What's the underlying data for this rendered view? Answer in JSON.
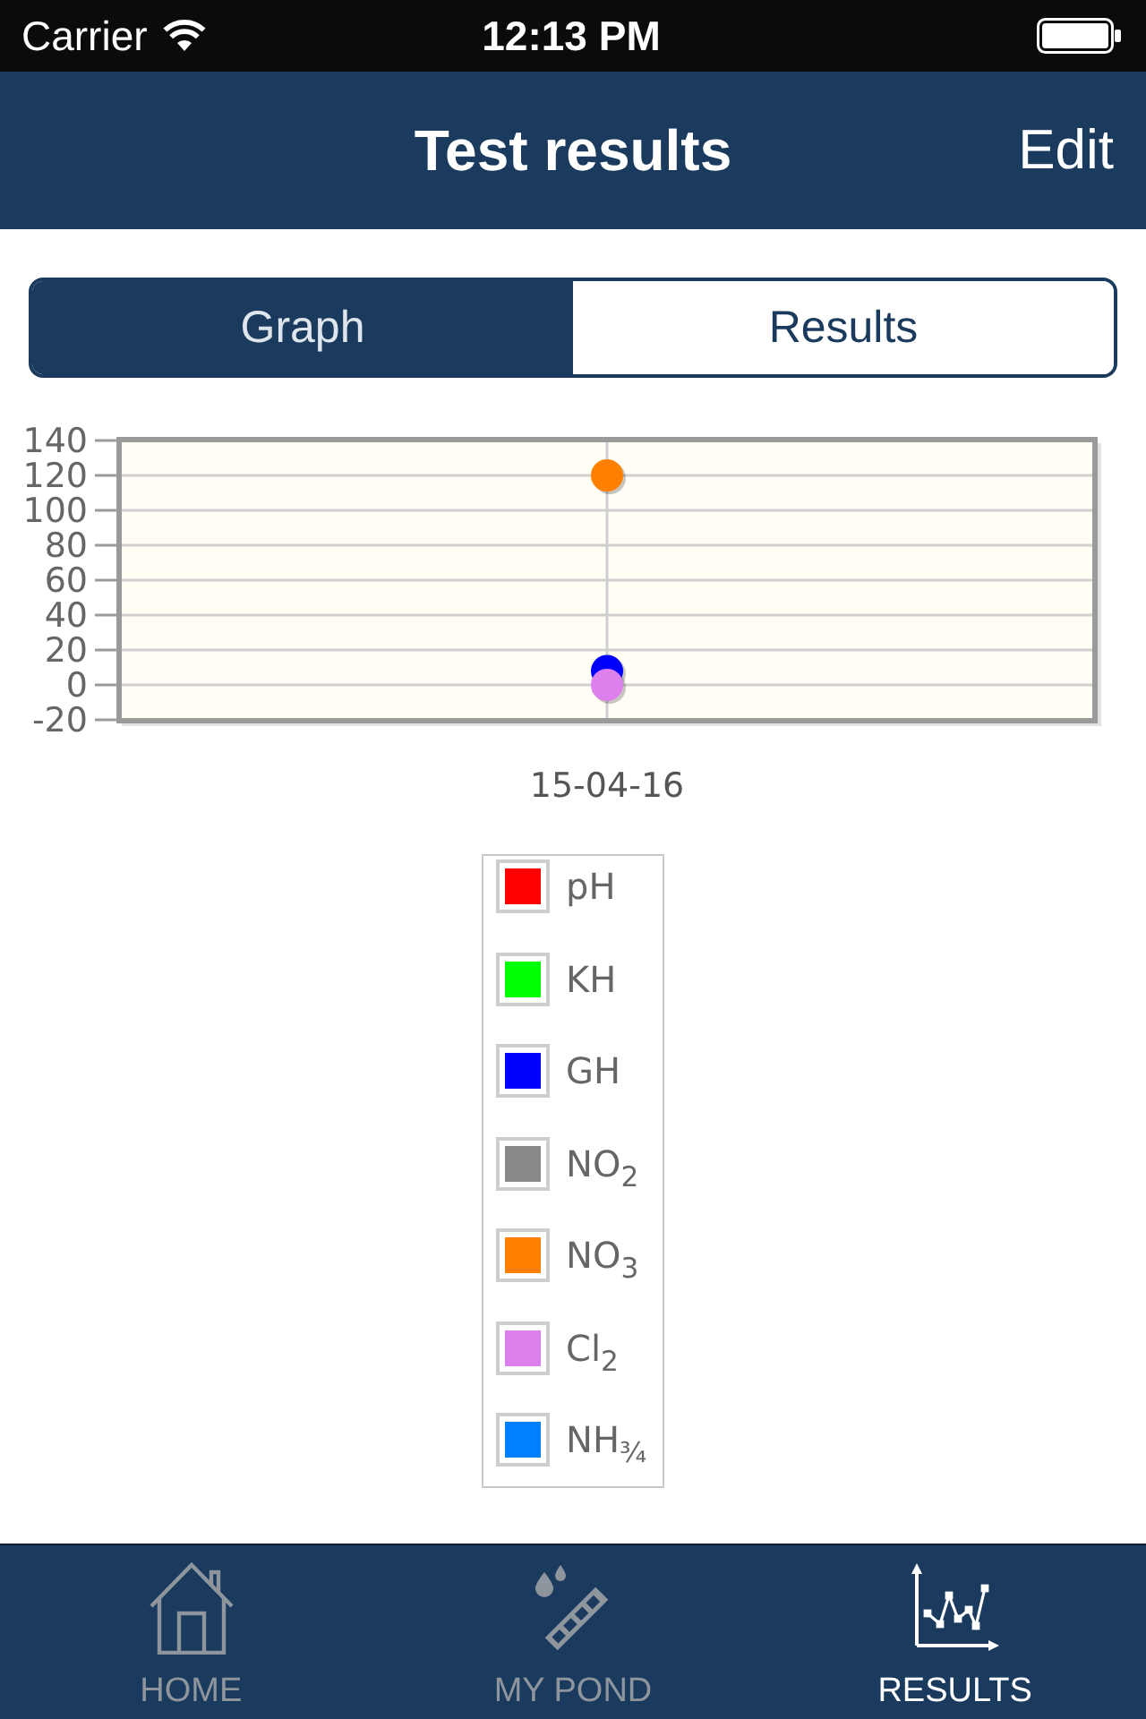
{
  "status_bar": {
    "carrier": "Carrier",
    "time": "12:13 PM"
  },
  "nav_bar": {
    "title": "Test results",
    "action": "Edit"
  },
  "segmented_control": [
    {
      "label": "Graph",
      "selected": true
    },
    {
      "label": "Results",
      "selected": false
    }
  ],
  "chart": {
    "chart_data": {
      "type": "scatter",
      "grid": true,
      "categories": [
        "15-04-16"
      ],
      "series": [
        {
          "name": "pH",
          "color": "#ff0000",
          "values": [
            null
          ]
        },
        {
          "name": "KH",
          "color": "#00ff00",
          "values": [
            null
          ]
        },
        {
          "name": "GH",
          "color": "#0000ff",
          "values": [
            8
          ]
        },
        {
          "name": "NO$_{2}$",
          "color": "#888888",
          "values": [
            null
          ]
        },
        {
          "name": "NO$_{3}$",
          "color": "#ff8000",
          "values": [
            120
          ]
        },
        {
          "name": "Cl$_{2}$",
          "color": "#dd80ee",
          "values": [
            0
          ]
        },
        {
          "name": "NH$_{¾}$",
          "color": "#0080ff",
          "values": [
            null
          ]
        }
      ],
      "ylim": [
        -20,
        140
      ],
      "yticks": [
        -20,
        0,
        20,
        40,
        60,
        80,
        100,
        120,
        140
      ]
    }
  },
  "tab_bar": [
    {
      "label": "HOME",
      "selected": false
    },
    {
      "label": "MY POND",
      "selected": false
    },
    {
      "label": "RESULTS",
      "selected": true
    }
  ]
}
